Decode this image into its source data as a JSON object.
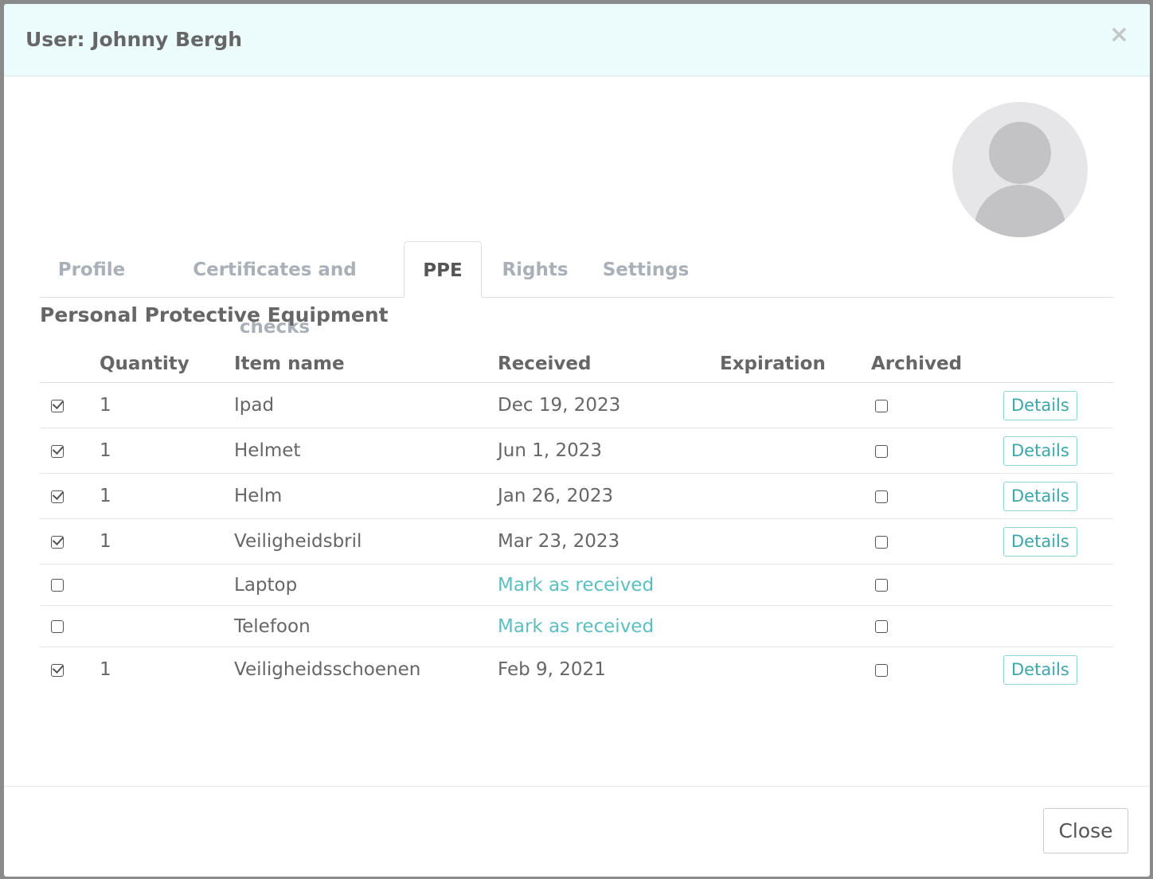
{
  "modal": {
    "title": "User: Johnny Bergh",
    "close_symbol": "×"
  },
  "tabs": [
    {
      "label": "Profile",
      "active": false
    },
    {
      "label": "Certificates and checks",
      "active": false
    },
    {
      "label": "PPE",
      "active": true
    },
    {
      "label": "Rights",
      "active": false
    },
    {
      "label": "Settings",
      "active": false
    }
  ],
  "section_title": "Personal Protective Equipment",
  "table": {
    "headers": [
      "",
      "Quantity",
      "Item name",
      "Received",
      "Expiration",
      "Archived",
      ""
    ],
    "rows": [
      {
        "checked": true,
        "quantity": "1",
        "item": "Ipad",
        "received": "Dec 19, 2023",
        "expiration": "",
        "archived": false,
        "action": "Details"
      },
      {
        "checked": true,
        "quantity": "1",
        "item": "Helmet",
        "received": "Jun 1, 2023",
        "expiration": "",
        "archived": false,
        "action": "Details"
      },
      {
        "checked": true,
        "quantity": "1",
        "item": "Helm",
        "received": "Jan 26, 2023",
        "expiration": "",
        "archived": false,
        "action": "Details"
      },
      {
        "checked": true,
        "quantity": "1",
        "item": "Veiligheidsbril",
        "received": "Mar 23, 2023",
        "expiration": "",
        "archived": false,
        "action": "Details"
      },
      {
        "checked": false,
        "quantity": "",
        "item": "Laptop",
        "received": "Mark as received",
        "expiration": "",
        "archived": false,
        "action": ""
      },
      {
        "checked": false,
        "quantity": "",
        "item": "Telefoon",
        "received": "Mark as received",
        "expiration": "",
        "archived": false,
        "action": ""
      },
      {
        "checked": true,
        "quantity": "1",
        "item": "Veiligheidsschoenen",
        "received": "Feb 9, 2021",
        "expiration": "",
        "archived": false,
        "action": "Details"
      }
    ]
  },
  "footer": {
    "close_label": "Close"
  },
  "colors": {
    "header_bg": "#ecfbfc",
    "accent": "#5bbfc1",
    "text": "#666666"
  },
  "icons": {
    "avatar": "user-silhouette-icon",
    "close": "close-icon"
  }
}
